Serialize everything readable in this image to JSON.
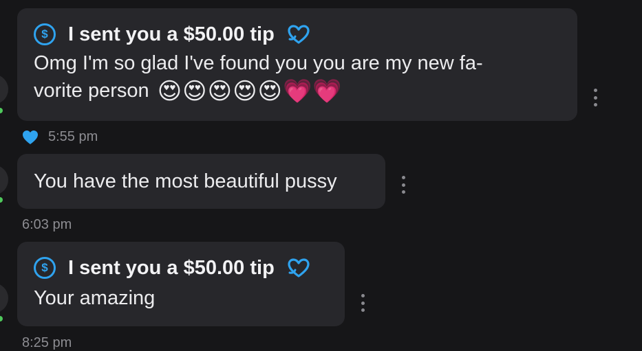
{
  "messages": [
    {
      "tip_text": "I sent you a $50.00 tip",
      "body_line1": "Omg I'm so glad I've found you you are my new fa-",
      "body_line2": "vorite person",
      "emojis": [
        "😍",
        "😍",
        "😍",
        "😍",
        "😍",
        "💗",
        "💗"
      ],
      "timestamp": "5:55 pm",
      "liked": true
    },
    {
      "body": "You have the most beautiful pussy",
      "timestamp": "6:03 pm"
    },
    {
      "tip_text": "I sent you a $50.00 tip",
      "body": "Your amazing",
      "timestamp": "8:25 pm"
    }
  ],
  "icons": {
    "tip": "dollar-circle-icon",
    "tip_heart": "heart-outline-icon",
    "like": "heart-filled-icon",
    "more": "kebab-menu-icon"
  },
  "colors": {
    "background": "#161618",
    "bubble": "#27272b",
    "accent": "#2fa3ef",
    "timestamp": "#8d8d92",
    "online": "#4fc95c"
  }
}
